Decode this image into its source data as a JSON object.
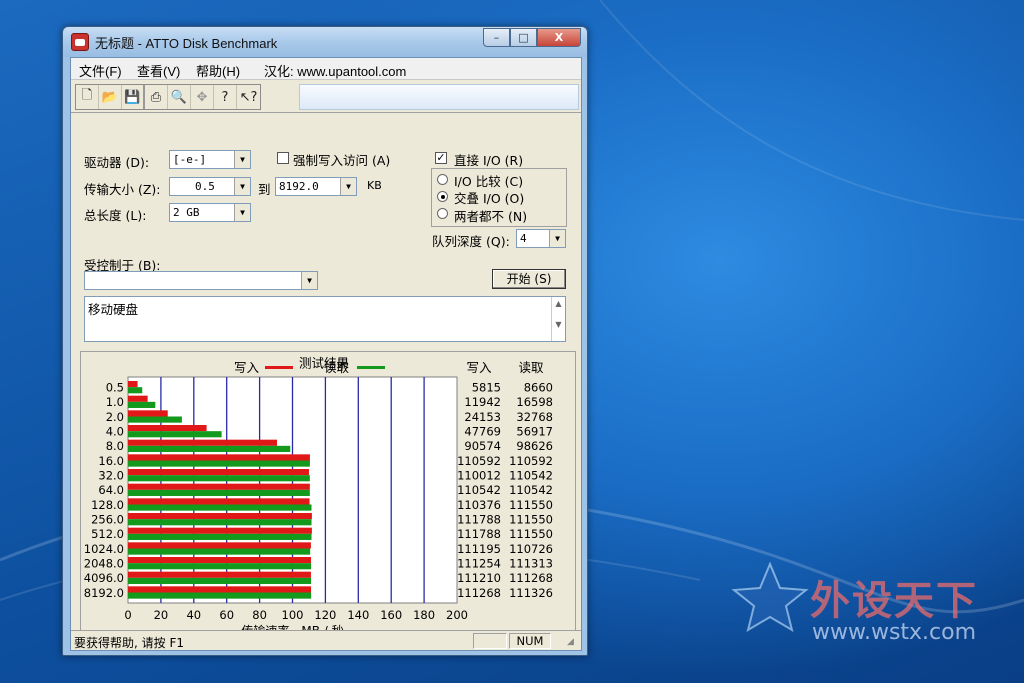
{
  "window": {
    "title": "无标题 - ATTO Disk Benchmark",
    "minimize": "–",
    "maximize": "□",
    "close": "X"
  },
  "menu": {
    "file": "文件(F)",
    "view": "查看(V)",
    "help": "帮助(H)",
    "localized_by": "汉化: www.upantool.com"
  },
  "toolbar": {
    "icons": [
      "new-file-icon",
      "open-folder-icon",
      "save-icon",
      "print-icon",
      "print-preview-icon",
      "move-icon",
      "help-icon",
      "context-help-icon"
    ]
  },
  "settings": {
    "drive_label": "驱动器 (D):",
    "drive_value": "[-e-]",
    "transfer_label": "传输大小 (Z):",
    "transfer_from": "0.5",
    "to_label": "到",
    "transfer_to": "8192.0",
    "kb_label": "KB",
    "total_label": "总长度 (L):",
    "total_value": "2 GB",
    "force_write_label": "强制写入访问 (A)",
    "direct_io_label": "直接 I/O (R)",
    "io_compare_label": "I/O 比较 (C)",
    "overlapped_io_label": "交叠 I/O (O)",
    "neither_label": "两者都不 (N)",
    "queue_depth_label": "队列深度 (Q):",
    "queue_depth_value": "4",
    "controlled_by_label": "受控制于 (B):",
    "controlled_by_value": "",
    "start_button": "开始 (S)",
    "description": "移动硬盘"
  },
  "chart_data": {
    "type": "bar",
    "title": "测试结果",
    "legend": [
      "写入",
      "读取"
    ],
    "colors": {
      "write": "#e01818",
      "read": "#139a1d"
    },
    "categories": [
      "0.5",
      "1.0",
      "2.0",
      "4.0",
      "8.0",
      "16.0",
      "32.0",
      "64.0",
      "128.0",
      "256.0",
      "512.0",
      "1024.0",
      "2048.0",
      "4096.0",
      "8192.0"
    ],
    "series": [
      {
        "name": "写入",
        "values": [
          5815,
          11942,
          24153,
          47769,
          90574,
          110592,
          110012,
          110542,
          110376,
          111788,
          111788,
          111195,
          111254,
          111210,
          111268
        ]
      },
      {
        "name": "读取",
        "values": [
          8660,
          16598,
          32768,
          56917,
          98626,
          110592,
          110542,
          110542,
          111550,
          111550,
          111550,
          110726,
          111313,
          111268,
          111326
        ]
      }
    ],
    "table_headers": [
      "写入",
      "读取"
    ],
    "x_ticks": [
      "0",
      "20",
      "40",
      "60",
      "80",
      "100",
      "120",
      "140",
      "160",
      "180",
      "200"
    ],
    "xlabel": "传输速率 - MB / 秒",
    "xlim": [
      0,
      200
    ]
  },
  "status": {
    "help_text": "要获得帮助, 请按 F1",
    "num": "NUM"
  },
  "watermark": {
    "brand": "外设天下",
    "url": "www.wstx.com"
  }
}
